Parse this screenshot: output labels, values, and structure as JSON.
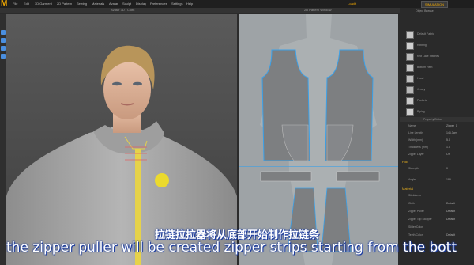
{
  "app": {
    "logo_letter": "M"
  },
  "menu": [
    "File",
    "Edit",
    "3D Garment",
    "2D Pattern",
    "Sewing",
    "Materials",
    "Avatar",
    "Sculpt",
    "Display",
    "Preferences",
    "Settings",
    "Help"
  ],
  "menu_right": {
    "user": "LoadIt",
    "simulation": "SIMULATION"
  },
  "panels": {
    "view3d_title": "Avatar 3D / Cloth",
    "view2d_title": "2D Pattern Window",
    "object_browser_title": "Object Browser",
    "property_title": "Property Editor"
  },
  "fabric_list": [
    {
      "label": "Default Fabric",
      "color": "#c8c8c8"
    },
    {
      "label": "Ribbing",
      "color": "#d0d0d0"
    },
    {
      "label": "Knit Lace Stitches",
      "color": "#bdbdbd"
    },
    {
      "label": "Bottom Hem",
      "color": "#c4c4c4"
    },
    {
      "label": "Hood",
      "color": "#bfbfbf"
    },
    {
      "label": "Jersey",
      "color": "#b8b8b8"
    },
    {
      "label": "Pockets",
      "color": "#c9c9c9"
    },
    {
      "label": "Piping",
      "color": "#cfcfcf"
    }
  ],
  "properties": [
    {
      "label": "Name",
      "value": "Zipper_1"
    },
    {
      "label": "Line Length",
      "value": "146.3cm"
    },
    {
      "label": "Width (mm)",
      "value": "5.0"
    },
    {
      "label": "Thickness (mm)",
      "value": "1.0"
    },
    {
      "label": "Zipper Layer",
      "value": "On"
    }
  ],
  "sections": {
    "fold": "Fold",
    "material": "Material"
  },
  "fold_props": [
    {
      "label": "Strength",
      "value": "0"
    },
    {
      "label": "Angle",
      "value": "180"
    }
  ],
  "material_props": [
    {
      "label": "Stickiness",
      "value": ""
    },
    {
      "label": "Cloth",
      "value": "Default"
    },
    {
      "label": "Zipper Puller",
      "value": "Default"
    },
    {
      "label": "Zipper Top Stopper",
      "value": "Default"
    },
    {
      "label": "Slider Color",
      "value": ""
    },
    {
      "label": "Teeth Color",
      "value": "Default"
    }
  ],
  "subtitles": {
    "cn": "拉链拉拉器将从底部开始制作拉链条",
    "en": "the zipper puller will be created zipper strips starting from the bott"
  },
  "colors": {
    "accent": "#f2a900",
    "pattern_bg": "#9ea3a6",
    "pattern_piece": "#7d7f81",
    "outline": "#3aa0e8",
    "zipper": "#e6d24a"
  }
}
